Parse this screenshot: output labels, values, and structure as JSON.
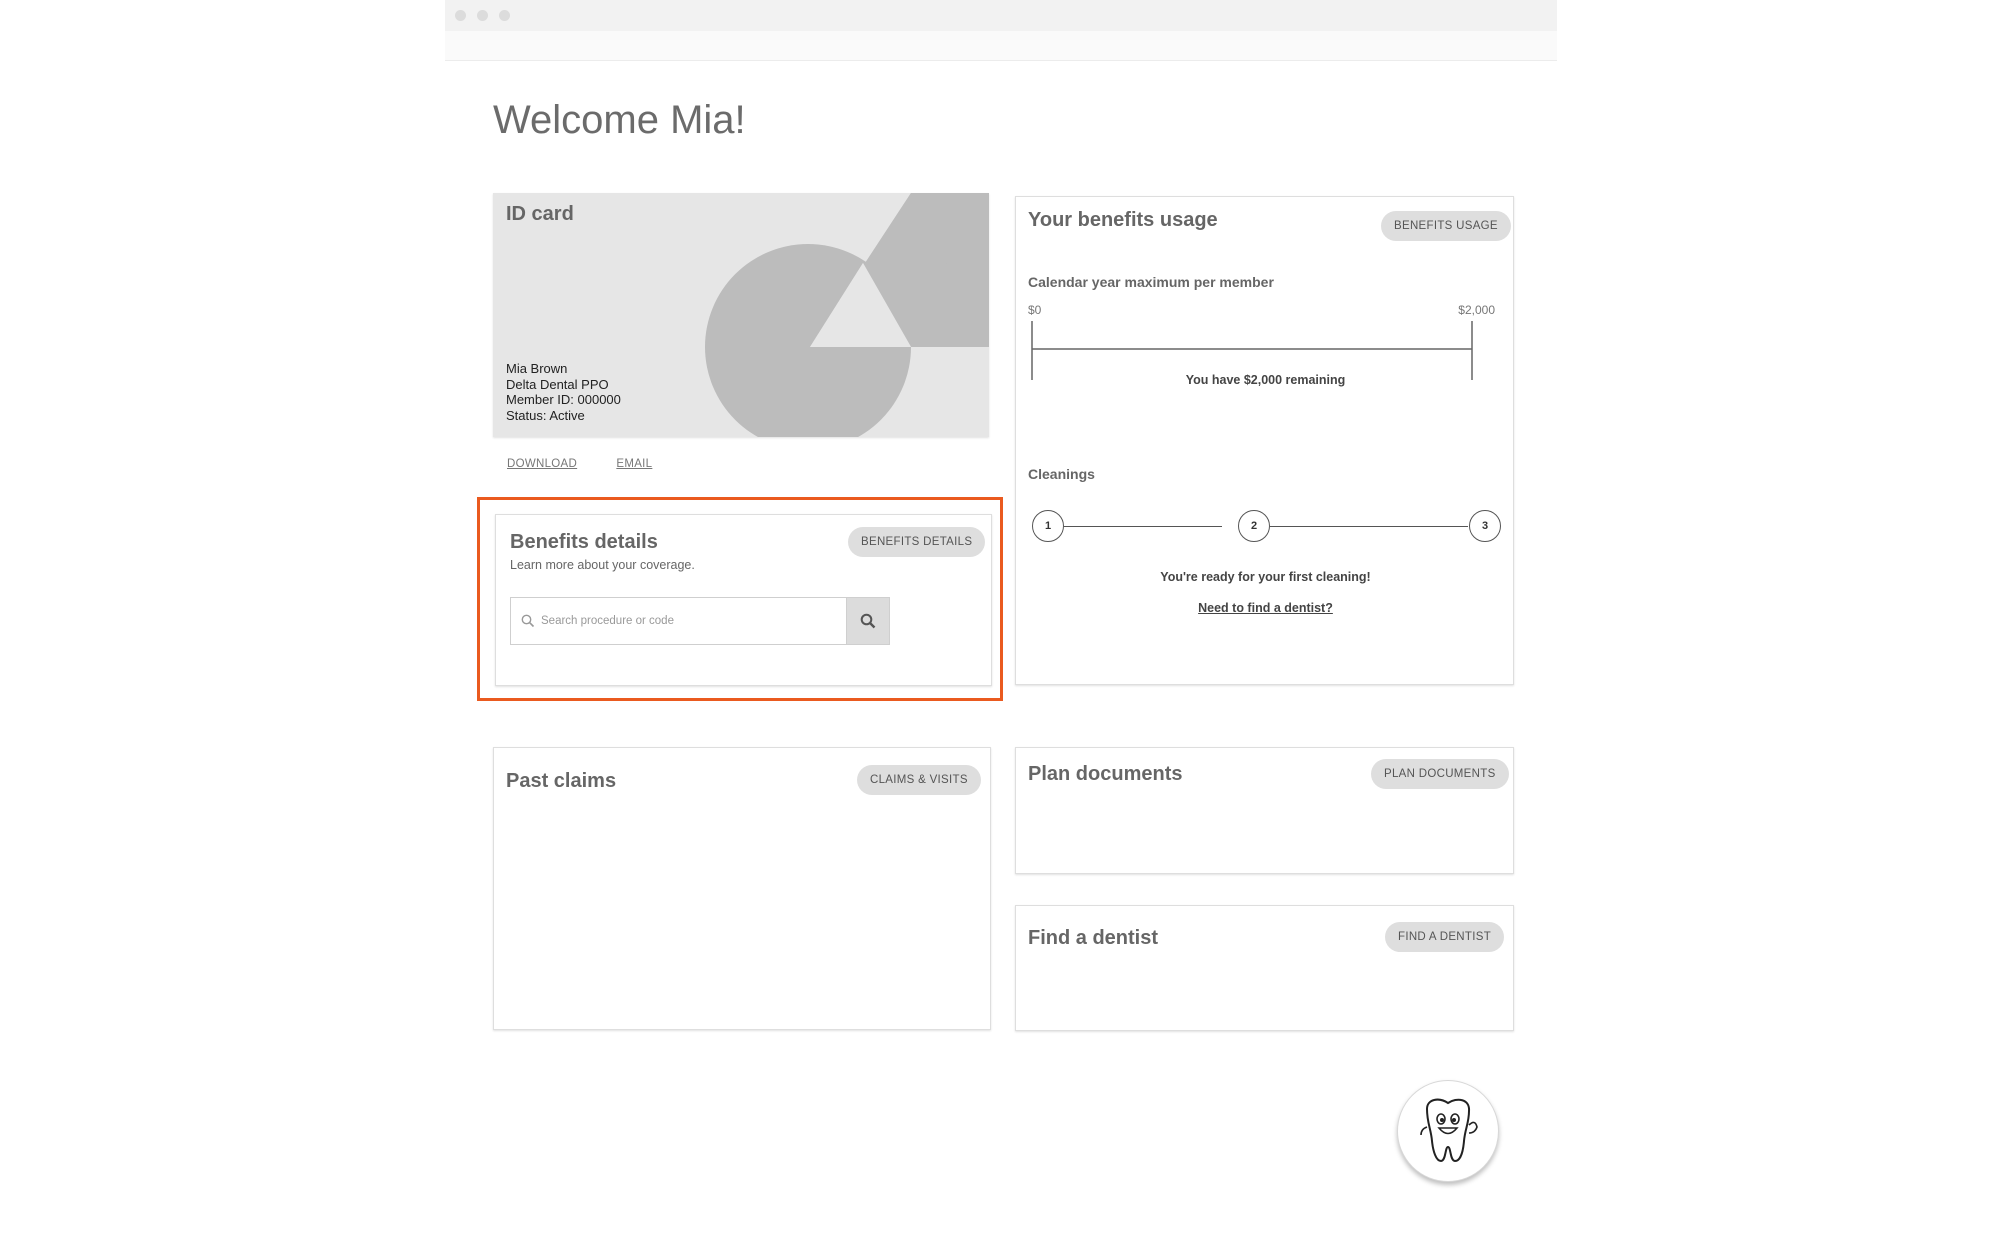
{
  "welcome": "Welcome Mia!",
  "id_card": {
    "title": "ID card",
    "name": "Mia Brown",
    "plan": "Delta Dental PPO",
    "member_id": "Member ID: 000000",
    "status": "Status: Active",
    "download_label": "DOWNLOAD",
    "email_label": "EMAIL"
  },
  "benefits_details": {
    "title": "Benefits details",
    "subtitle": "Learn more about your coverage.",
    "button": "BENEFITS DETAILS",
    "search_placeholder": "Search procedure or code",
    "search_value": ""
  },
  "benefits_usage": {
    "title": "Your benefits usage",
    "button": "BENEFITS USAGE",
    "maximum_label": "Calendar year maximum per member",
    "min_label": "$0",
    "max_label": "$2,000",
    "remaining_text": "You have $2,000 remaining",
    "remaining_fraction": 1.0,
    "cleanings_label": "Cleanings",
    "steps": [
      "1",
      "2",
      "3"
    ],
    "cleanings_message": "You're ready for your first cleaning!",
    "find_dentist_link": "Need to find a dentist?"
  },
  "past_claims": {
    "title": "Past claims",
    "button": "CLAIMS & VISITS"
  },
  "plan_documents": {
    "title": "Plan documents",
    "button": "PLAN DOCUMENTS"
  },
  "find_dentist": {
    "title": "Find a dentist",
    "button": "FIND A DENTIST"
  },
  "colors": {
    "highlight": "#ea5a1f",
    "pill": "#dedede",
    "card_bg": "#e6e6e6"
  }
}
